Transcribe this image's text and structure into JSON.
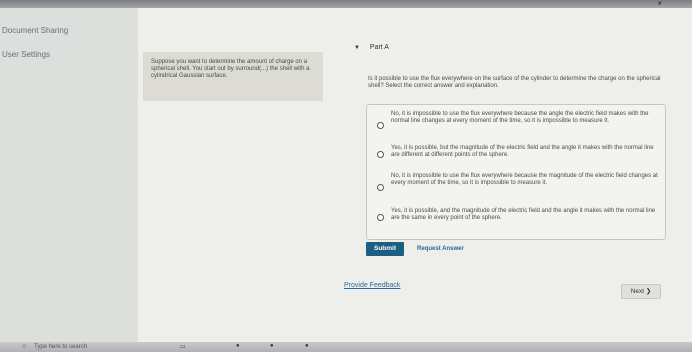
{
  "window": {
    "close_glyph": "×"
  },
  "sidebar": {
    "items": [
      {
        "label": "Document Sharing"
      },
      {
        "label": "User Settings"
      }
    ]
  },
  "problem": {
    "text": "Suppose you want to determine the amount of charge on a spherical shell. You start out by surround(...) the shell with a cylindrical Gaussian surface."
  },
  "part": {
    "label": "Part A",
    "toggle_glyph": "▼",
    "question": "Is it possible to use the flux everywhere on the surface of the cylinder to determine the charge on the spherical shell? Select the correct answer and explanation.",
    "options": [
      {
        "text": "No, it is impossible to use the flux everywhere because the angle the electric field makes with the normal line changes at every moment of the time, so it is impossible to measure it.",
        "selected": false
      },
      {
        "text": "Yes, it is possible, but the magnitude of the electric field and the angle it makes with the normal line are different at different points of the sphere.",
        "selected": false
      },
      {
        "text": "No, it is impossible to use the flux everywhere because the magnitude of the electric field changes at every moment of the time, so it is impossible to measure it.",
        "selected": false
      },
      {
        "text": "Yes, it is possible, and the magnitude of the electric field and the angle it makes with the normal line are the same in every point of the sphere.",
        "selected": false
      }
    ]
  },
  "actions": {
    "submit_label": "Submit",
    "request_answer_label": "Request Answer",
    "feedback_label": "Provide Feedback",
    "next_label": "Next ❯"
  },
  "taskbar": {
    "search_placeholder": "Type here to search",
    "search_glyph": "○"
  },
  "colors": {
    "submit_bg": "#1d5f83",
    "link": "#2a6a9a"
  }
}
